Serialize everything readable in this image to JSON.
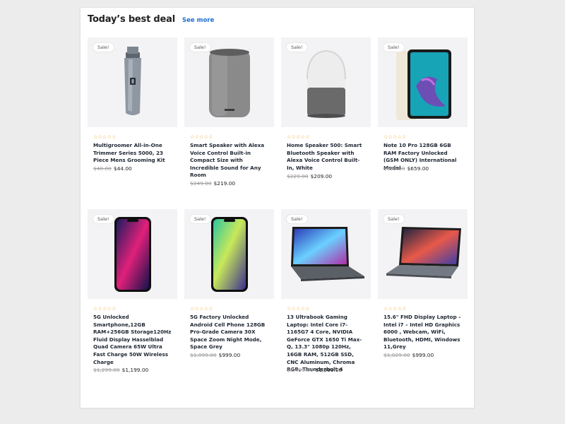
{
  "header": {
    "title": "Today’s best deal",
    "see_more": "See more"
  },
  "colors": {
    "accent": "#1f6fd6",
    "star": "#e8a628"
  },
  "products": [
    {
      "badge": "Sale!",
      "rating": "☆☆☆☆☆",
      "name": "Multigroomer All-in-One Trimmer Series 5000, 23 Piece Mens Grooming Kit",
      "old_price": "$40.00",
      "price": "$44.00",
      "icon": "hair-trimmer-icon"
    },
    {
      "badge": "Sale!",
      "rating": "☆☆☆☆☆",
      "name": "Smart Speaker with Alexa Voice Control Built-in Compact Size with Incredible Sound for Any Room",
      "old_price": "$249.00",
      "price": "$219.00",
      "icon": "smart-speaker-icon"
    },
    {
      "badge": "Sale!",
      "rating": "☆☆☆☆☆",
      "name": "Home Speaker 500: Smart Bluetooth Speaker with Alexa Voice Control Built-In, White",
      "old_price": "$229.00",
      "price": "$209.00",
      "icon": "home-speaker-icon"
    },
    {
      "badge": "Sale!",
      "rating": "☆☆☆☆☆",
      "name": "Note 10 Pro 128GB 6GB RAM Factory Unlocked (GSM ONLY) International Model",
      "old_price": "$699.00",
      "price": "$659.00",
      "icon": "tablet-icon"
    },
    {
      "badge": "Sale!",
      "rating": "☆☆☆☆☆",
      "name": "5G Unlocked Smartphone,12GB RAM+256GB Storage120Hz Fluid Display Hasselblad Quad Camera 65W Ultra Fast Charge 50W Wireless Charge",
      "old_price": "$1,299.00",
      "price": "$1,199.00",
      "icon": "smartphone-icon"
    },
    {
      "badge": "Sale!",
      "rating": "☆☆☆☆☆",
      "name": "5G Factory Unlocked Android Cell Phone 128GB Pro-Grade Camera 30X Space Zoom Night Mode, Space Grey",
      "old_price": "$1,099.00",
      "price": "$999.00",
      "icon": "smartphone-icon"
    },
    {
      "badge": "Sale!",
      "rating": "☆☆☆☆☆",
      "name": "13 Ultrabook Gaming Laptop: Intel Core i7-1165G7 4 Core, NVIDIA GeForce GTX 1650 Ti Max-Q, 13.3\" 1080p 120Hz, 16GB RAM, 512GB SSD, CNC Aluminum, Chroma RGB, Thunderbolt 4",
      "old_price": "$1,499.00",
      "price": "$1,399.00",
      "icon": "laptop-icon"
    },
    {
      "badge": "Sale!",
      "rating": "☆☆☆☆☆",
      "name": "15.6\" FHD Display Laptop – Intel i7 – Intel HD Graphics 6000 , Webcam, WiFi, Bluetooth, HDMI, Windows 11,Grey",
      "old_price": "$1,029.00",
      "price": "$999.00",
      "icon": "laptop-icon"
    }
  ]
}
